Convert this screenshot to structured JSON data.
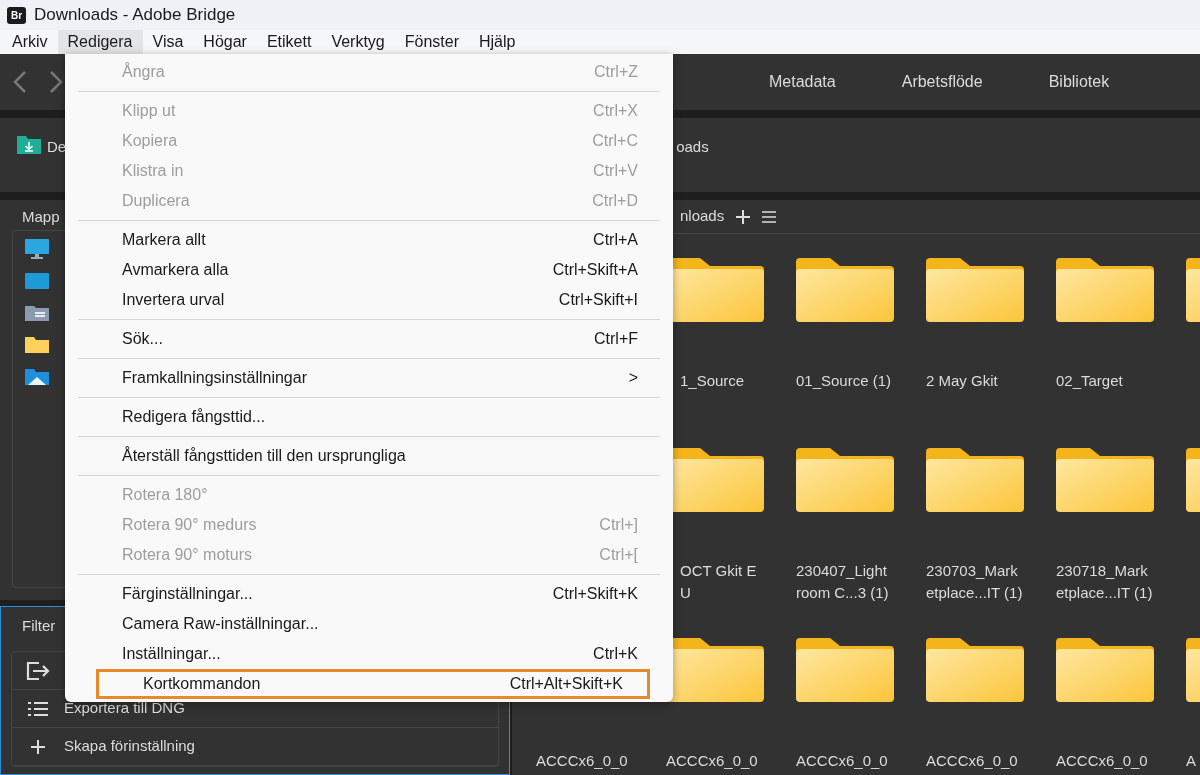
{
  "window": {
    "title": "Downloads - Adobe Bridge",
    "logo": "Br"
  },
  "menubar": [
    {
      "label": "Arkiv",
      "selected": false
    },
    {
      "label": "Redigera",
      "selected": true
    },
    {
      "label": "Visa",
      "selected": false
    },
    {
      "label": "Högar",
      "selected": false
    },
    {
      "label": "Etikett",
      "selected": false
    },
    {
      "label": "Verktyg",
      "selected": false
    },
    {
      "label": "Fönster",
      "selected": false
    },
    {
      "label": "Hjälp",
      "selected": false
    }
  ],
  "workspace_tabs": [
    "Metadata",
    "Arbetsflöde",
    "Bibliotek"
  ],
  "path_bar": {
    "left_text": "De",
    "right_text": "oads"
  },
  "folders_panel": {
    "title": "Mapp",
    "items": [
      {
        "kind": "monitor"
      },
      {
        "kind": "desktop"
      },
      {
        "kind": "documents"
      },
      {
        "kind": "folder"
      },
      {
        "kind": "pictures"
      }
    ]
  },
  "filter_panel": {
    "title": "Filter",
    "items": [
      {
        "kind": "export"
      },
      {
        "kind": "list",
        "label": "Exportera till DNG"
      },
      {
        "kind": "add",
        "label": "Skapa förinställning"
      }
    ]
  },
  "content": {
    "header": "nloads",
    "rows": [
      {
        "items": [
          {
            "kind": "folder",
            "label": [
              "1_Source"
            ]
          },
          {
            "kind": "folder",
            "label": [
              "01_Source (1)"
            ]
          },
          {
            "kind": "folder",
            "label": [
              "2 May Gkit"
            ]
          },
          {
            "kind": "folder",
            "label": [
              "02_Target"
            ]
          },
          {
            "kind": "folder"
          }
        ]
      },
      {
        "items": [
          {
            "kind": "folder",
            "label": [
              "OCT Gkit E",
              "U"
            ]
          },
          {
            "kind": "folder",
            "label": [
              "230407_Light",
              "room C...3 (1)"
            ]
          },
          {
            "kind": "folder",
            "label": [
              "230703_Mark",
              "etplace...IT (1)"
            ]
          },
          {
            "kind": "folder",
            "label": [
              "230718_Mark",
              "etplace...IT (1)"
            ]
          },
          {
            "kind": "folder"
          }
        ]
      },
      {
        "items": [
          {
            "label": [
              "ACCCx6_0_0"
            ]
          },
          {
            "kind": "folder",
            "label": [
              "ACCCx6_0_0"
            ]
          },
          {
            "kind": "folder",
            "label": [
              "ACCCx6_0_0"
            ]
          },
          {
            "kind": "folder",
            "label": [
              "ACCCx6_0_0"
            ]
          },
          {
            "kind": "folder",
            "label": [
              "ACCCx6_0_0"
            ]
          },
          {
            "kind": "folder",
            "label": [
              "A"
            ]
          }
        ]
      }
    ]
  },
  "edit_menu": [
    {
      "kind": "item",
      "label": "Ångra",
      "shortcut": "Ctrl+Z",
      "disabled": true,
      "highlighted": false
    },
    {
      "kind": "separator"
    },
    {
      "kind": "item",
      "label": "Klipp ut",
      "shortcut": "Ctrl+X",
      "disabled": true,
      "highlighted": false
    },
    {
      "kind": "item",
      "label": "Kopiera",
      "shortcut": "Ctrl+C",
      "disabled": true,
      "highlighted": false
    },
    {
      "kind": "item",
      "label": "Klistra in",
      "shortcut": "Ctrl+V",
      "disabled": true,
      "highlighted": false
    },
    {
      "kind": "item",
      "label": "Duplicera",
      "shortcut": "Ctrl+D",
      "disabled": true,
      "highlighted": false
    },
    {
      "kind": "separator"
    },
    {
      "kind": "item",
      "label": "Markera allt",
      "shortcut": "Ctrl+A",
      "disabled": false,
      "highlighted": false
    },
    {
      "kind": "item",
      "label": "Avmarkera alla",
      "shortcut": "Ctrl+Skift+A",
      "disabled": false,
      "highlighted": false
    },
    {
      "kind": "item",
      "label": "Invertera urval",
      "shortcut": "Ctrl+Skift+I",
      "disabled": false,
      "highlighted": false
    },
    {
      "kind": "separator"
    },
    {
      "kind": "item",
      "label": "Sök...",
      "shortcut": "Ctrl+F",
      "disabled": false,
      "highlighted": false
    },
    {
      "kind": "separator"
    },
    {
      "kind": "submenu",
      "label": "Framkallningsinställningar",
      "arrow": ">",
      "disabled": false,
      "highlighted": false
    },
    {
      "kind": "separator"
    },
    {
      "kind": "item",
      "label": "Redigera fångsttid...",
      "disabled": false,
      "highlighted": false
    },
    {
      "kind": "separator"
    },
    {
      "kind": "item",
      "label": "Återställ fångsttiden till den ursprungliga",
      "disabled": false,
      "highlighted": false
    },
    {
      "kind": "separator"
    },
    {
      "kind": "item",
      "label": "Rotera 180°",
      "disabled": true,
      "highlighted": false
    },
    {
      "kind": "item",
      "label": "Rotera 90° medurs",
      "shortcut": "Ctrl+]",
      "disabled": true,
      "highlighted": false
    },
    {
      "kind": "item",
      "label": "Rotera 90° moturs",
      "shortcut": "Ctrl+[",
      "disabled": true,
      "highlighted": false
    },
    {
      "kind": "separator"
    },
    {
      "kind": "item",
      "label": "Färginställningar...",
      "shortcut": "Ctrl+Skift+K",
      "disabled": false,
      "highlighted": false
    },
    {
      "kind": "item",
      "label": "Camera Raw-inställningar...",
      "disabled": false,
      "highlighted": false
    },
    {
      "kind": "item",
      "label": "Inställningar...",
      "shortcut": "Ctrl+K",
      "disabled": false,
      "highlighted": false
    },
    {
      "kind": "item",
      "label": "Kortkommandon",
      "shortcut": "Ctrl+Alt+Skift+K",
      "disabled": false,
      "highlighted": true
    }
  ]
}
